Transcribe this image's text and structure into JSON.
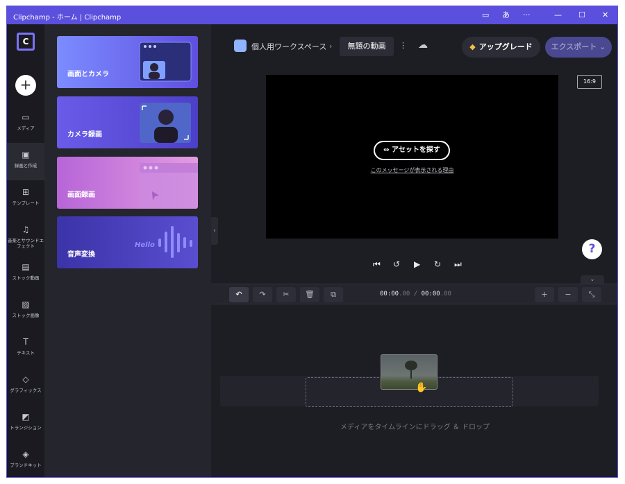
{
  "window": {
    "title": "Clipchamp - ホーム | Clipchamp",
    "controls": {
      "camera": "▭",
      "translate": "あ",
      "more": "···",
      "minimize": "—",
      "maximize": "☐",
      "close": "✕"
    }
  },
  "rail": {
    "logo": "C",
    "create": "+",
    "items": [
      {
        "icon": "▭",
        "label": "メディア"
      },
      {
        "icon": "▣",
        "label": "録画と作成"
      },
      {
        "icon": "⊞",
        "label": "テンプレート"
      },
      {
        "icon": "♫",
        "label": "音楽とサウンドエフェクト"
      },
      {
        "icon": "▤",
        "label": "ストック動画"
      },
      {
        "icon": "▨",
        "label": "ストック画像"
      },
      {
        "icon": "T",
        "label": "テキスト"
      },
      {
        "icon": "◇",
        "label": "グラフィックス"
      },
      {
        "icon": "◩",
        "label": "トランジション"
      },
      {
        "icon": "◈",
        "label": "ブランドキット"
      }
    ]
  },
  "panel": {
    "cards": [
      {
        "label": "画面とカメラ"
      },
      {
        "label": "カメラ録画"
      },
      {
        "label": "画面録画"
      },
      {
        "label": "音声変換",
        "graphic_text": "Hello"
      }
    ],
    "collapse_icon": "‹"
  },
  "topbar": {
    "workspace": "個人用ワークスペース",
    "separator": "›",
    "project_title": "無題の動画",
    "more": "⋮",
    "sync_icon": "☁",
    "upgrade_icon": "◆",
    "upgrade": "アップグレード",
    "export": "エクスポート ⌄",
    "ratio": "16:9"
  },
  "preview": {
    "find_assets": "⇔ アセットを探す",
    "why_link": "このメッセージが表示される理由"
  },
  "help": "?",
  "playback": {
    "start": "⏮",
    "back5": "↺",
    "play": "▶",
    "fwd5": "↻",
    "end": "⏭"
  },
  "collapse_down": "⌄",
  "toolbar": {
    "undo": "↶",
    "redo": "↷",
    "cut": "✂",
    "delete": "🗑",
    "duplicate": "⧉",
    "timecode": {
      "cur": "00:00",
      "cur_ms": ".00",
      "sep": " / ",
      "total": "00:00",
      "total_ms": ".00"
    },
    "zoom_in": "+",
    "zoom_out": "−",
    "fit": "⤡"
  },
  "timeline": {
    "drop_hint": "メディアをタイムラインにドラッグ ＆ ドロップ",
    "hand_icon": "✋"
  }
}
